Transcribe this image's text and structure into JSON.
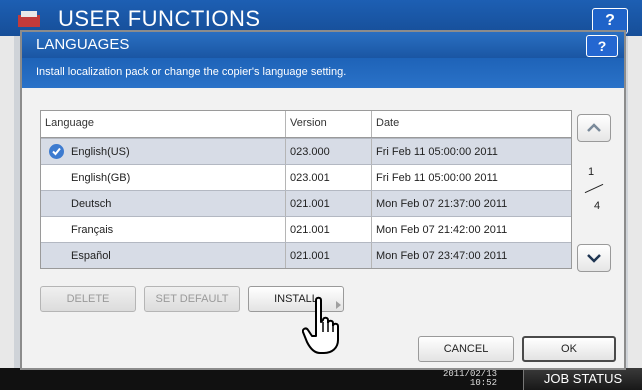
{
  "background": {
    "app_title": "USER FUNCTIONS",
    "help_label": "?",
    "clock_line1": "2011/02/13",
    "clock_line2": "10:52",
    "job_status_label": "JOB STATUS"
  },
  "dialog": {
    "title": "LANGUAGES",
    "help_label": "?",
    "message": "Install localization pack or change the copier's language setting."
  },
  "table": {
    "headers": [
      "Language",
      "Version",
      "Date"
    ],
    "rows": [
      {
        "language": "English(US)",
        "version": "023.000",
        "date": "Fri Feb 11 05:00:00 2011",
        "selected": true
      },
      {
        "language": "English(GB)",
        "version": "023.001",
        "date": "Fri Feb 11 05:00:00 2011",
        "selected": false
      },
      {
        "language": "Deutsch",
        "version": "021.001",
        "date": "Mon Feb 07 21:37:00 2011",
        "selected": false
      },
      {
        "language": "Français",
        "version": "021.001",
        "date": "Mon Feb 07 21:42:00 2011",
        "selected": false
      },
      {
        "language": "Español",
        "version": "021.001",
        "date": "Mon Feb 07 23:47:00 2011",
        "selected": false
      }
    ]
  },
  "pagination": {
    "current": "1",
    "total": "4"
  },
  "buttons": {
    "delete": "DELETE",
    "set_default": "SET DEFAULT",
    "install": "INSTALL",
    "cancel": "CANCEL",
    "ok": "OK"
  },
  "icons": {
    "selected": "check-circle-icon",
    "scroll_up": "chevron-up-icon",
    "scroll_down": "chevron-down-icon",
    "pointer": "hand-pointer-icon"
  },
  "colors": {
    "header_blue": "#1a56a3",
    "selected_row": "#d7dce6",
    "check_blue": "#3d7bd0"
  }
}
